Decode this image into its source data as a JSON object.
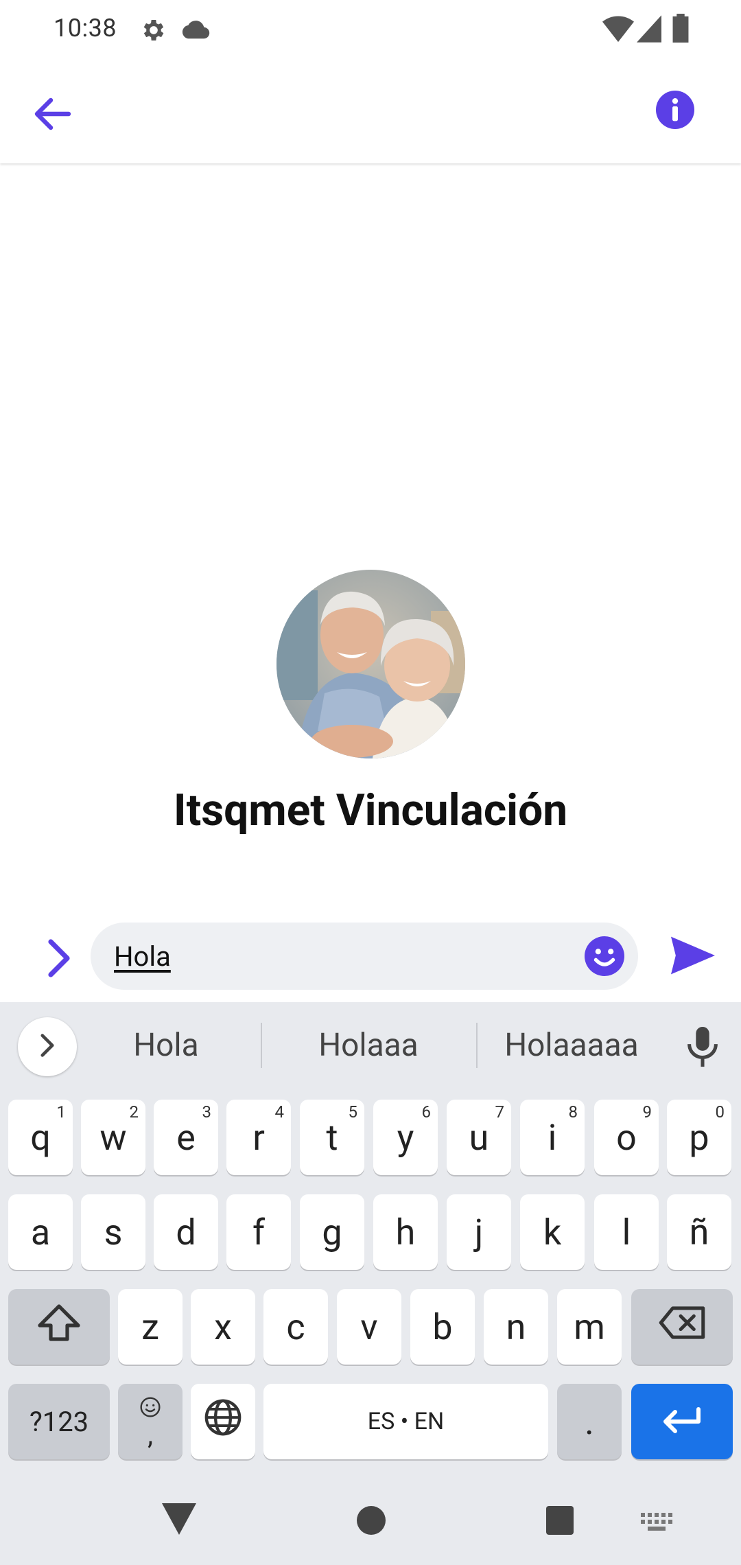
{
  "status_bar": {
    "time": "10:38"
  },
  "conversation": {
    "contact_name": "Itsqmet Vinculación"
  },
  "composer": {
    "message_value": "Hola"
  },
  "keyboard": {
    "suggestions": [
      "Hola",
      "Holaaa",
      "Holaaaaa"
    ],
    "row1": [
      {
        "key": "q",
        "hint": "1"
      },
      {
        "key": "w",
        "hint": "2"
      },
      {
        "key": "e",
        "hint": "3"
      },
      {
        "key": "r",
        "hint": "4"
      },
      {
        "key": "t",
        "hint": "5"
      },
      {
        "key": "y",
        "hint": "6"
      },
      {
        "key": "u",
        "hint": "7"
      },
      {
        "key": "i",
        "hint": "8"
      },
      {
        "key": "o",
        "hint": "9"
      },
      {
        "key": "p",
        "hint": "0"
      }
    ],
    "row2": [
      "a",
      "s",
      "d",
      "f",
      "g",
      "h",
      "j",
      "k",
      "l",
      "ñ"
    ],
    "row3": [
      "z",
      "x",
      "c",
      "v",
      "b",
      "n",
      "m"
    ],
    "symbols_label": "?123",
    "comma_label": ",",
    "space_label": "ES • EN",
    "period_label": "."
  },
  "colors": {
    "accent": "#5b3fe6",
    "enter_key": "#1a73e8",
    "keyboard_bg": "#e8eaee"
  }
}
